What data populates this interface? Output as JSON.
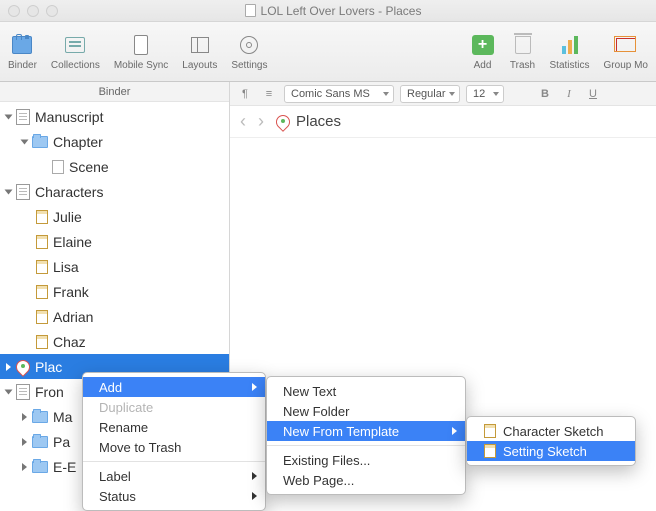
{
  "window": {
    "title": "LOL Left Over Lovers - Places"
  },
  "toolbar": {
    "binder": "Binder",
    "collections": "Collections",
    "mobile": "Mobile Sync",
    "layouts": "Layouts",
    "settings": "Settings",
    "add": "Add",
    "trash": "Trash",
    "stats": "Statistics",
    "group": "Group Mo"
  },
  "binder_header": "Binder",
  "tree": {
    "manuscript": "Manuscript",
    "chapter": "Chapter",
    "scene": "Scene",
    "characters": "Characters",
    "chars": [
      "Julie",
      "Elaine",
      "Lisa",
      "Frank",
      "Adrian",
      "Chaz"
    ],
    "places": "Plac",
    "front": "Fron",
    "ma": "Ma",
    "pa": "Pa",
    "ee": "E-E"
  },
  "format": {
    "para": "¶",
    "align": "≡",
    "font": "Comic Sans MS",
    "weight": "Regular",
    "size": "12",
    "b": "B",
    "i": "I",
    "u": "U"
  },
  "nav": {
    "title": "Places"
  },
  "ctx1": {
    "add": "Add",
    "duplicate": "Duplicate",
    "rename": "Rename",
    "trash": "Move to Trash",
    "label": "Label",
    "status": "Status"
  },
  "ctx2": {
    "newtext": "New Text",
    "newfolder": "New Folder",
    "newtemplate": "New From Template",
    "existing": "Existing Files...",
    "web": "Web Page..."
  },
  "ctx3": {
    "charsketch": "Character Sketch",
    "setsketch": "Setting Sketch"
  }
}
